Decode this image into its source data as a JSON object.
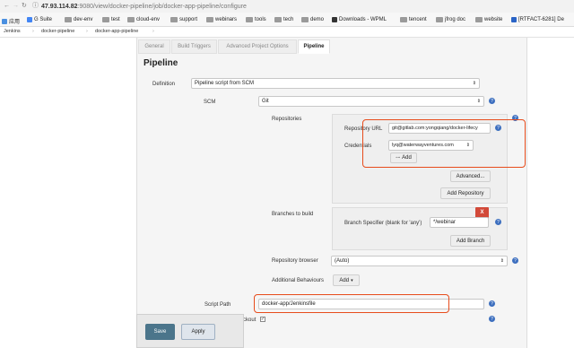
{
  "browser": {
    "url_host": "47.93.114.82",
    "url_path": ":9080/view/docker-pipeline/job/docker-app-pipeline/configure",
    "bookmarks": [
      "应用",
      "G Suite",
      "dev-env",
      "test",
      "cloud-env",
      "support",
      "webinars",
      "tools",
      "tech",
      "demo",
      "Downloads - WPML",
      "tencent",
      "jfrog doc",
      "website",
      "[RTFACT-6281] De"
    ]
  },
  "breadcrumb": [
    "Jenkins",
    "docker-pipeline",
    "docker-app-pipeline"
  ],
  "tabs": [
    "General",
    "Build Triggers",
    "Advanced Project Options",
    "Pipeline"
  ],
  "section_title": "Pipeline",
  "definition": {
    "label": "Definition",
    "value": "Pipeline script from SCM"
  },
  "scm": {
    "label": "SCM",
    "value": "Git"
  },
  "repositories": {
    "label": "Repositories",
    "url_label": "Repository URL",
    "url_value": "git@gitlab.com:yongqiang/docker-lifecy",
    "cred_label": "Credentials",
    "cred_value": "lyq@waterwayventures.com",
    "add_label": "Add",
    "advanced_label": "Advanced...",
    "add_repo_label": "Add Repository"
  },
  "branches": {
    "label": "Branches to build",
    "spec_label": "Branch Specifier (blank for 'any')",
    "spec_value": "*/webinar",
    "x_label": "X",
    "add_branch_label": "Add Branch"
  },
  "repo_browser": {
    "label": "Repository browser",
    "value": "(Auto)"
  },
  "additional": {
    "label": "Additional Behaviours",
    "add_label": "Add"
  },
  "script_path": {
    "label": "Script Path",
    "value": "docker-app/Jenkinsfile"
  },
  "lightweight": {
    "label": "ight checkout"
  },
  "syntax_link": "ntax",
  "buttons": {
    "save": "Save",
    "apply": "Apply"
  },
  "colors": {
    "accent_red": "#e74c1c",
    "help_blue": "#3d6fbf",
    "save_blue": "#4b758b"
  }
}
